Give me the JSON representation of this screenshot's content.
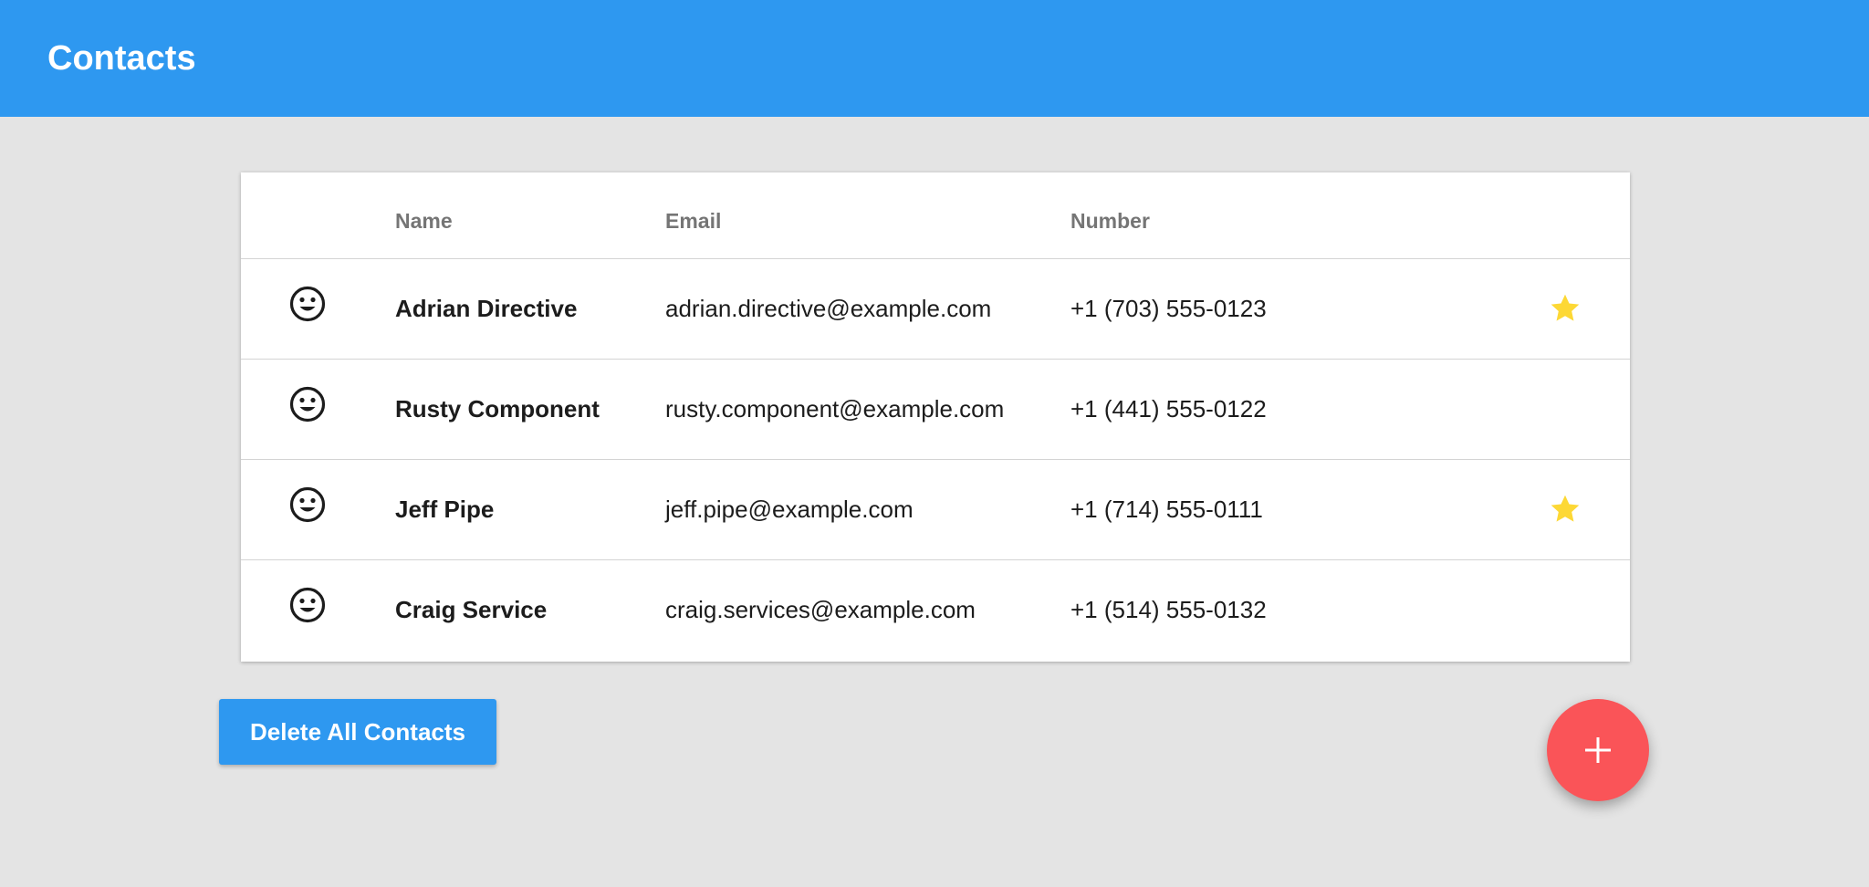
{
  "app_bar": {
    "title": "Contacts",
    "color": "#2e98f0"
  },
  "table": {
    "headers": {
      "name": "Name",
      "email": "Email",
      "number": "Number"
    },
    "rows": [
      {
        "avatar_icon": "smiley-face-icon",
        "name": "Adrian Directive",
        "email": "adrian.directive@example.com",
        "number": "+1 (703) 555-0123",
        "starred": true
      },
      {
        "avatar_icon": "smiley-face-icon",
        "name": "Rusty Component",
        "email": "rusty.component@example.com",
        "number": "+1 (441) 555-0122",
        "starred": false
      },
      {
        "avatar_icon": "smiley-face-icon",
        "name": "Jeff Pipe",
        "email": "jeff.pipe@example.com",
        "number": "+1 (714) 555-0111",
        "starred": true
      },
      {
        "avatar_icon": "smiley-face-icon",
        "name": "Craig Service",
        "email": "craig.services@example.com",
        "number": "+1 (514) 555-0132",
        "starred": false
      }
    ]
  },
  "actions": {
    "delete_all_label": "Delete All Contacts",
    "add_icon": "plus-icon"
  },
  "colors": {
    "star": "#fdd835",
    "fab": "#fa5458",
    "primary": "#2e98f0",
    "background": "#e4e4e4"
  }
}
